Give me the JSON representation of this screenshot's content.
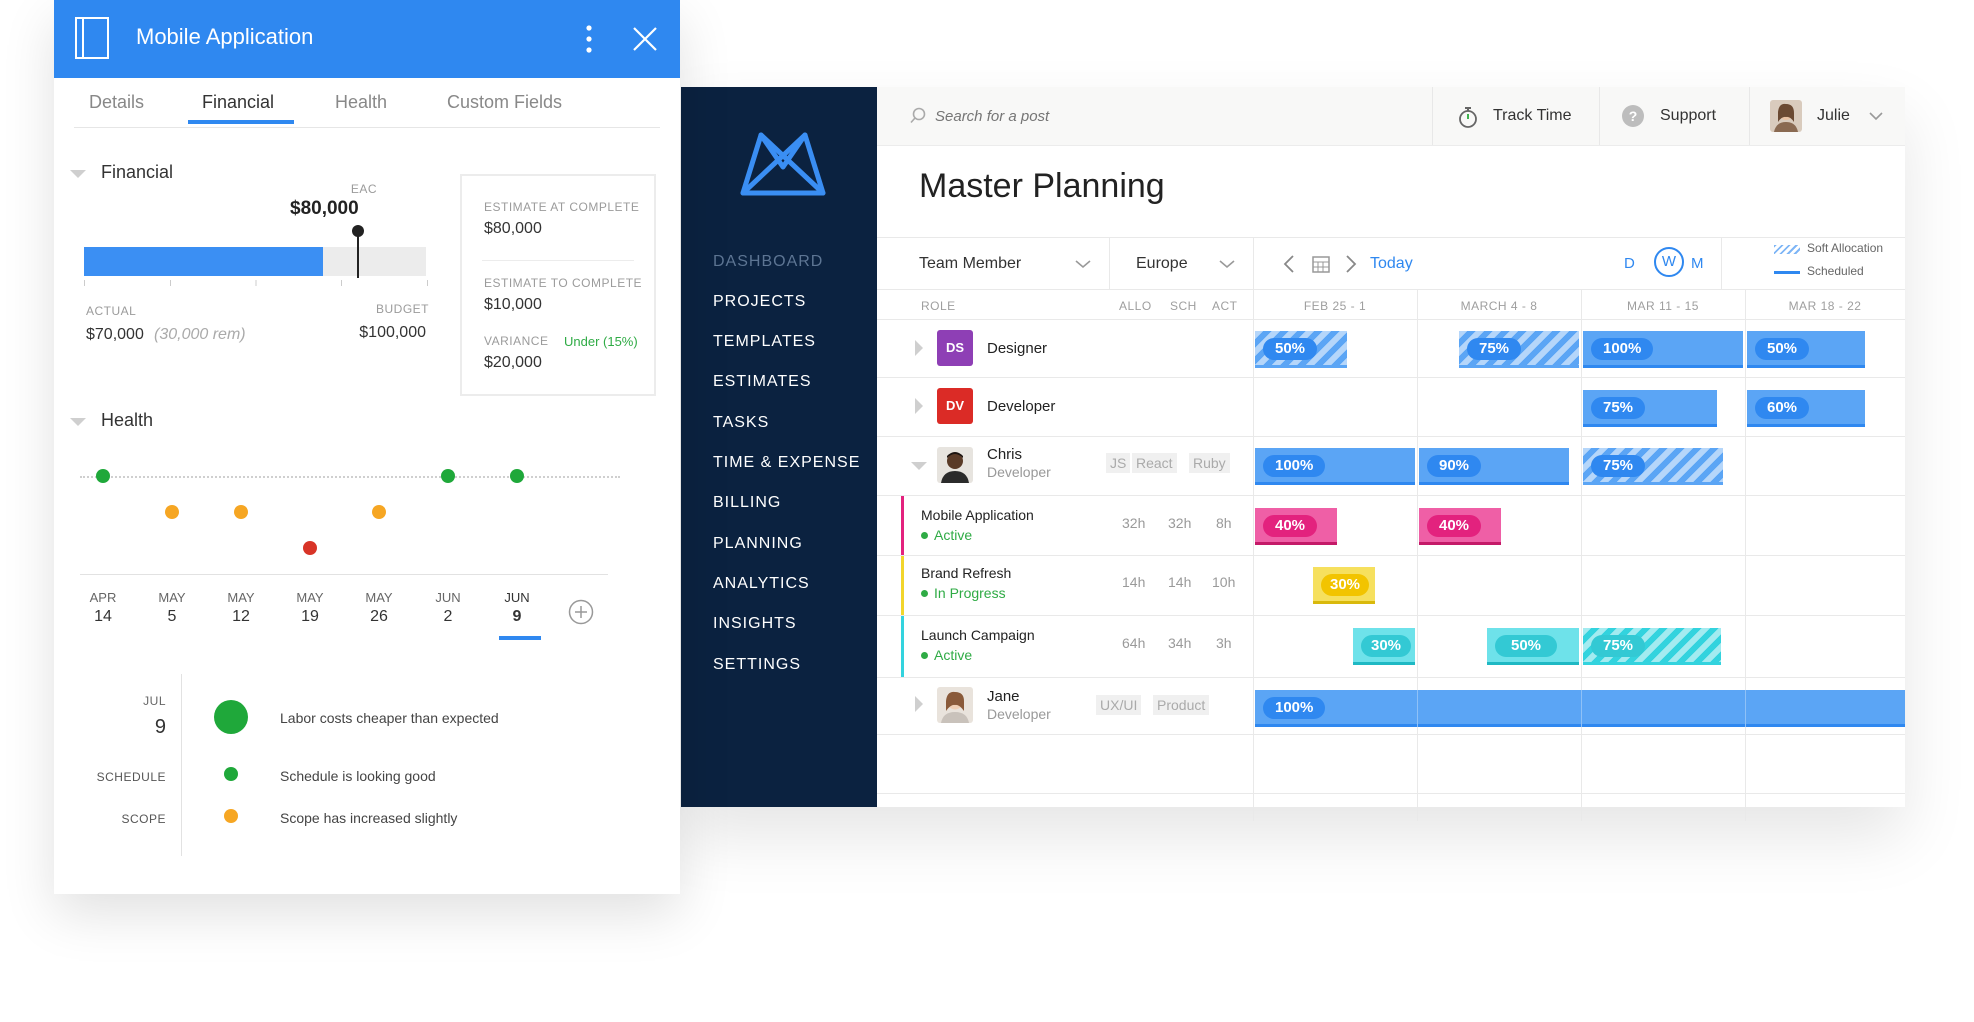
{
  "colors": {
    "sidebar": "#0b2240",
    "accent": "#2f88f0",
    "bar_blue": "#5ba5f5",
    "bar_pink": "#e3227e",
    "bar_yellow": "#f2d52b",
    "bar_teal": "#33d3de",
    "designer_badge": "#8e3fb5",
    "developer_badge": "#db2b26",
    "health_green": "#1fa83a",
    "health_orange": "#f6a623",
    "health_red": "#d83427",
    "status_green": "#2fab45"
  },
  "side_panel": {
    "title": "Mobile Application",
    "icons": {
      "project": "notebook-icon",
      "more": "more-vertical-icon",
      "close": "close-icon"
    },
    "tabs": [
      {
        "label": "Details",
        "active": false
      },
      {
        "label": "Financial",
        "active": true
      },
      {
        "label": "Health",
        "active": false
      },
      {
        "label": "Custom Fields",
        "active": false
      }
    ],
    "financial": {
      "section_label": "Financial",
      "eac_label": "EAC",
      "eac_value": "$80,000",
      "actual_label": "ACTUAL",
      "actual_value": "$70,000",
      "actual_remaining": "(30,000 rem)",
      "budget_label": "BUDGET",
      "budget_value": "$100,000",
      "progress_fraction": 0.7,
      "eac_fraction": 0.8,
      "summary": {
        "estimate_at_complete_label": "ESTIMATE AT COMPLETE",
        "estimate_at_complete_value": "$80,000",
        "estimate_to_complete_label": "ESTIMATE TO COMPLETE",
        "estimate_to_complete_value": "$10,000",
        "variance_label": "VARIANCE",
        "variance_value": "$20,000",
        "variance_status": "Under (15%)"
      }
    },
    "health": {
      "section_label": "Health",
      "dates": [
        {
          "month": "APR",
          "day": "14",
          "status": "green",
          "selected": false
        },
        {
          "month": "MAY",
          "day": "5",
          "status": "orange",
          "selected": false
        },
        {
          "month": "MAY",
          "day": "12",
          "status": "orange",
          "selected": false
        },
        {
          "month": "MAY",
          "day": "19",
          "status": "red",
          "selected": false
        },
        {
          "month": "MAY",
          "day": "26",
          "status": "orange",
          "selected": false
        },
        {
          "month": "JUN",
          "day": "2",
          "status": "green",
          "selected": false
        },
        {
          "month": "JUN",
          "day": "9",
          "status": "green",
          "selected": true
        }
      ],
      "add_icon": "plus-circle-icon",
      "detail": {
        "month": "JUL",
        "day": "9",
        "overall_text": "Labor costs cheaper than expected",
        "rows": [
          {
            "label": "SCHEDULE",
            "text": "Schedule is looking good",
            "status": "green"
          },
          {
            "label": "SCOPE",
            "text": "Scope has increased slightly",
            "status": "orange"
          }
        ]
      }
    }
  },
  "planner": {
    "logo_icon": "mavenlink-logo-icon",
    "nav": [
      {
        "label": "DASHBOARD",
        "dim": true
      },
      {
        "label": "PROJECTS",
        "dim": false
      },
      {
        "label": "TEMPLATES",
        "dim": false
      },
      {
        "label": "ESTIMATES",
        "dim": false
      },
      {
        "label": "TASKS",
        "dim": false
      },
      {
        "label": "TIME & EXPENSE",
        "dim": false
      },
      {
        "label": "BILLING",
        "dim": false
      },
      {
        "label": "PLANNING",
        "dim": false
      },
      {
        "label": "ANALYTICS",
        "dim": false
      },
      {
        "label": "INSIGHTS",
        "dim": false
      },
      {
        "label": "SETTINGS",
        "dim": false
      }
    ],
    "topbar": {
      "search_placeholder": "Search for a post",
      "track_time_label": "Track Time",
      "support_label": "Support",
      "user_name": "Julie"
    },
    "page_title": "Master Planning",
    "toolbar": {
      "group_by": "Team Member",
      "region": "Europe",
      "today_label": "Today",
      "scale_options": [
        "D",
        "W",
        "M"
      ],
      "scale_selected": "W",
      "legend_soft": "Soft Allocation",
      "legend_scheduled": "Scheduled"
    },
    "columns": {
      "role": "ROLE",
      "allo": "ALLO",
      "sch": "SCH",
      "act": "ACT",
      "weeks": [
        "FEB 25 - 1",
        "MARCH 4 - 8",
        "MAR 11 - 15",
        "MAR 18 - 22"
      ]
    },
    "rows": [
      {
        "name": "Designer",
        "badge": "DS",
        "bars": [
          "50%",
          "75%",
          "100%",
          "50%"
        ]
      },
      {
        "name": "Developer",
        "badge": "DV",
        "bars": [
          "75%",
          "60%"
        ]
      },
      {
        "name": "Chris",
        "subtitle": "Developer",
        "tags": [
          "JS",
          "React",
          "Ruby"
        ],
        "bars": [
          "100%",
          "90%",
          "75%"
        ]
      },
      {
        "name": "Mobile Application",
        "status": "Active",
        "allo": "32h",
        "sch": "32h",
        "act": "8h",
        "bars": [
          "40%",
          "40%"
        ]
      },
      {
        "name": "Brand Refresh",
        "status": "In Progress",
        "allo": "14h",
        "sch": "14h",
        "act": "10h",
        "bars": [
          "30%"
        ]
      },
      {
        "name": "Launch Campaign",
        "status": "Active",
        "allo": "64h",
        "sch": "34h",
        "act": "3h",
        "bars": [
          "30%",
          "50%",
          "75%"
        ]
      },
      {
        "name": "Jane",
        "subtitle": "Developer",
        "tags": [
          "UX/UI",
          "Product"
        ],
        "bars": [
          "100%"
        ]
      }
    ]
  }
}
